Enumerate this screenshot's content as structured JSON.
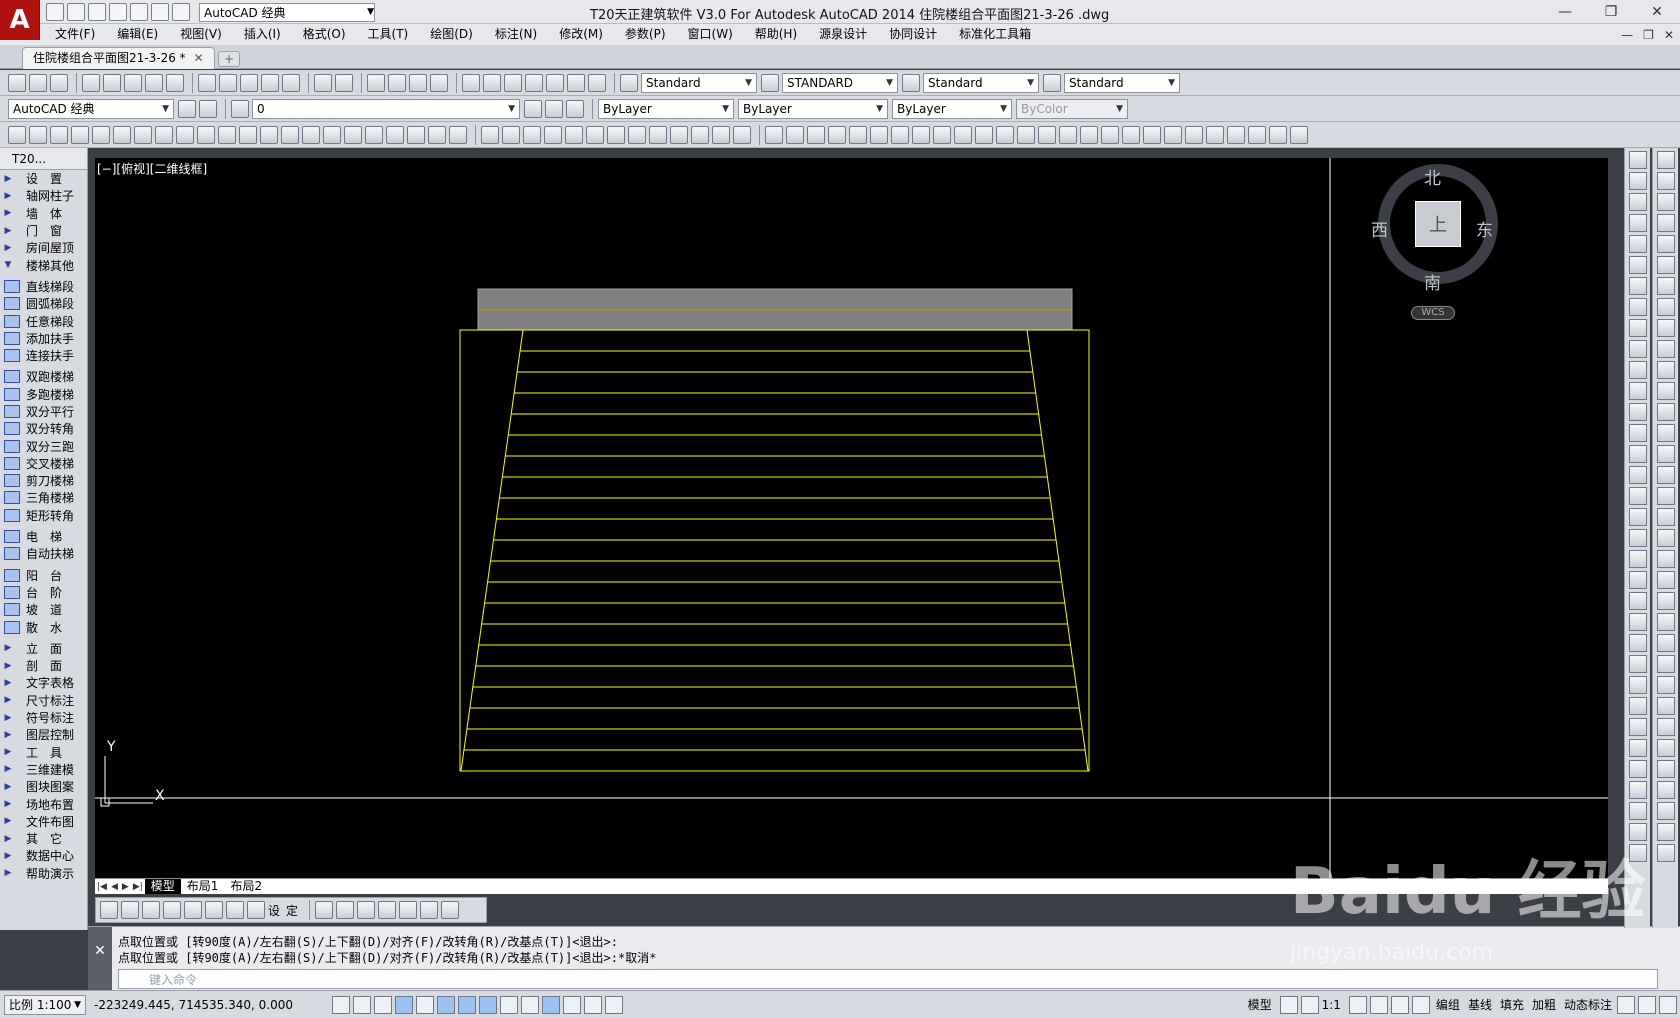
{
  "app": {
    "logo": "A",
    "title": "T20天正建筑软件 V3.0 For Autodesk AutoCAD 2014     住院楼组合平面图21-3-26 .dwg",
    "workspace": "AutoCAD 经典"
  },
  "window_controls": [
    "—",
    "❐",
    "✕"
  ],
  "mdi_controls": [
    "—",
    "❐",
    "✕"
  ],
  "menu": [
    "文件(F)",
    "编辑(E)",
    "视图(V)",
    "插入(I)",
    "格式(O)",
    "工具(T)",
    "绘图(D)",
    "标注(N)",
    "修改(M)",
    "参数(P)",
    "窗口(W)",
    "帮助(H)",
    "源泉设计",
    "协同设计",
    "标准化工具箱"
  ],
  "doc_tab": {
    "label": "住院楼组合平面图21-3-26 *",
    "close": "✕",
    "new": "+"
  },
  "styles_toolbar": {
    "text_style": "Standard",
    "dim_style": "STANDARD",
    "table_style": "Standard",
    "mleader_style": "Standard"
  },
  "layers_toolbar": {
    "workspace": "AutoCAD 经典",
    "layer": "0",
    "color": "ByLayer",
    "linetype": "ByLayer",
    "lineweight": "ByLayer",
    "plotstyle": "ByColor"
  },
  "palette": {
    "title": "T20...",
    "items": [
      {
        "kind": "cat",
        "label": "设　置"
      },
      {
        "kind": "cat",
        "label": "轴网柱子"
      },
      {
        "kind": "cat",
        "label": "墙　体"
      },
      {
        "kind": "cat",
        "label": "门　窗"
      },
      {
        "kind": "cat",
        "label": "房间屋顶"
      },
      {
        "kind": "cat",
        "label": "楼梯其他",
        "open": true
      },
      {
        "kind": "sep"
      },
      {
        "kind": "sub",
        "label": "直线梯段"
      },
      {
        "kind": "sub",
        "label": "圆弧梯段"
      },
      {
        "kind": "sub",
        "label": "任意梯段"
      },
      {
        "kind": "sub",
        "label": "添加扶手"
      },
      {
        "kind": "sub",
        "label": "连接扶手"
      },
      {
        "kind": "sep"
      },
      {
        "kind": "sub",
        "label": "双跑楼梯"
      },
      {
        "kind": "sub",
        "label": "多跑楼梯"
      },
      {
        "kind": "sub",
        "label": "双分平行"
      },
      {
        "kind": "sub",
        "label": "双分转角"
      },
      {
        "kind": "sub",
        "label": "双分三跑"
      },
      {
        "kind": "sub",
        "label": "交叉楼梯"
      },
      {
        "kind": "sub",
        "label": "剪刀楼梯"
      },
      {
        "kind": "sub",
        "label": "三角楼梯"
      },
      {
        "kind": "sub",
        "label": "矩形转角"
      },
      {
        "kind": "sep"
      },
      {
        "kind": "sub",
        "label": "电　梯"
      },
      {
        "kind": "sub",
        "label": "自动扶梯"
      },
      {
        "kind": "sep"
      },
      {
        "kind": "sub",
        "label": "阳　台"
      },
      {
        "kind": "sub",
        "label": "台　阶"
      },
      {
        "kind": "sub",
        "label": "坡　道"
      },
      {
        "kind": "sub",
        "label": "散　水"
      },
      {
        "kind": "sep"
      },
      {
        "kind": "cat",
        "label": "立　面"
      },
      {
        "kind": "cat",
        "label": "剖　面"
      },
      {
        "kind": "cat",
        "label": "文字表格"
      },
      {
        "kind": "cat",
        "label": "尺寸标注"
      },
      {
        "kind": "cat",
        "label": "符号标注"
      },
      {
        "kind": "cat",
        "label": "图层控制"
      },
      {
        "kind": "cat",
        "label": "工　具"
      },
      {
        "kind": "cat",
        "label": "三维建模"
      },
      {
        "kind": "cat",
        "label": "图块图案"
      },
      {
        "kind": "cat",
        "label": "场地布置"
      },
      {
        "kind": "cat",
        "label": "文件布图"
      },
      {
        "kind": "cat",
        "label": "其　它"
      },
      {
        "kind": "cat",
        "label": "数据中心"
      },
      {
        "kind": "cat",
        "label": "帮助演示"
      }
    ]
  },
  "viewport": {
    "label": "[−][俯视][二维线框]",
    "compass": {
      "north": "北",
      "south": "南",
      "east": "东",
      "west": "西",
      "face": "上"
    },
    "wcs": "WCS",
    "ucs": {
      "x": "X",
      "y": "Y"
    },
    "stair": {
      "steps": 21
    }
  },
  "layout_tabs": {
    "nav": [
      "|◀",
      "◀",
      "▶",
      "▶|"
    ],
    "tabs": [
      "模型",
      "布局1",
      "布局2"
    ],
    "active": 0
  },
  "tianzheng_strip": {
    "label1": "设",
    "label2": "定"
  },
  "command": {
    "lines": [
      "点取位置或 [转90度(A)/左右翻(S)/上下翻(D)/对齐(F)/改转角(R)/改基点(T)]<退出>:",
      "点取位置或 [转90度(A)/左右翻(S)/上下翻(D)/对齐(F)/改转角(R)/改基点(T)]<退出>:*取消*"
    ],
    "placeholder": "键入命令"
  },
  "status": {
    "scale": "比例 1:100",
    "coords": "-223249.445, 714535.340, 0.000",
    "model": "模型",
    "anno_scale": "1:1",
    "buttons": [
      "编组",
      "基线",
      "填充",
      "加粗",
      "动态标注"
    ]
  },
  "watermark": {
    "main": "Baidu 经验",
    "sub": "jingyan.baidu.com"
  },
  "colors": {
    "canvas": "#000000",
    "stair_lines": "#ffff00",
    "landing": "#808080",
    "accent": "#b01212"
  }
}
